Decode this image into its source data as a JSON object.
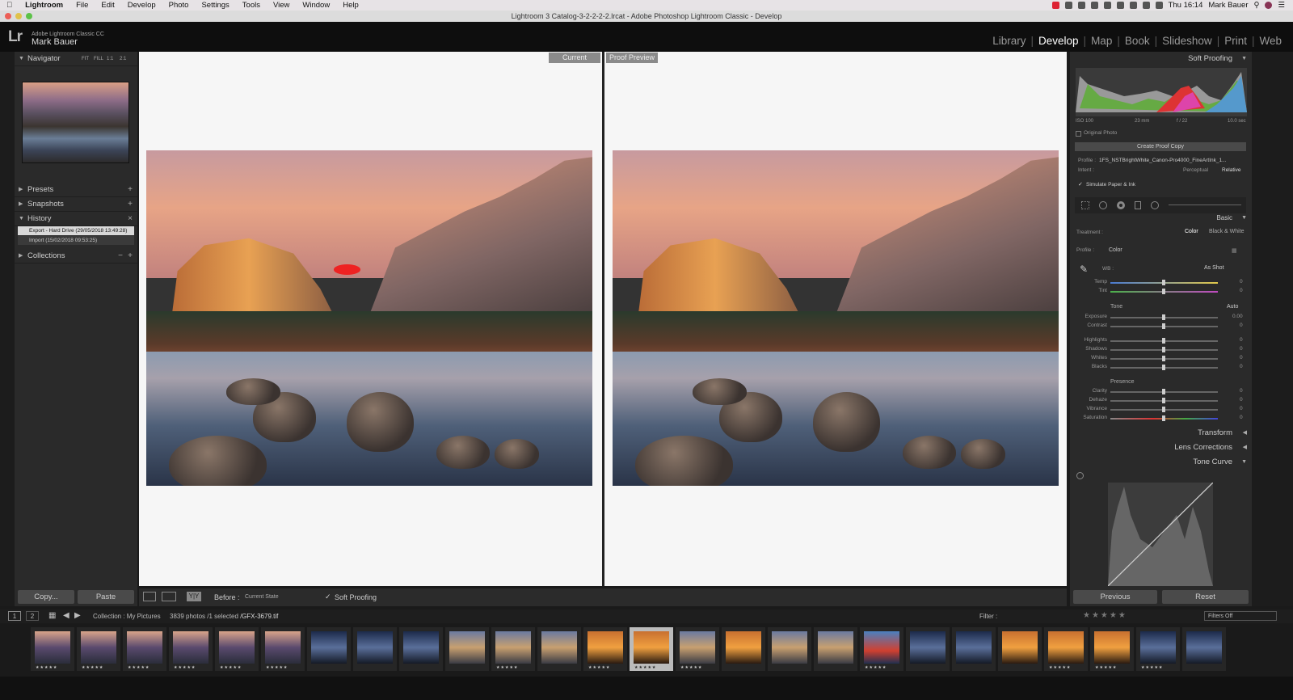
{
  "menubar": {
    "items": [
      "Lightroom",
      "File",
      "Edit",
      "Develop",
      "Photo",
      "Settings",
      "Tools",
      "View",
      "Window",
      "Help"
    ],
    "clock": "Thu 16:14",
    "user": "Mark Bauer"
  },
  "window": {
    "title": "Lightroom 3 Catalog-3-2-2-2-2.lrcat - Adobe Photoshop Lightroom Classic - Develop"
  },
  "identity": {
    "logo": "Lr",
    "product": "Adobe Lightroom Classic CC",
    "user": "Mark Bauer"
  },
  "modules": [
    {
      "label": "Library"
    },
    {
      "label": "Develop",
      "active": true
    },
    {
      "label": "Map"
    },
    {
      "label": "Book"
    },
    {
      "label": "Slideshow"
    },
    {
      "label": "Print"
    },
    {
      "label": "Web"
    }
  ],
  "left": {
    "navigator": {
      "title": "Navigator",
      "fit": "FIT",
      "fill": "FILL",
      "one": "1:1",
      "two": "2:1"
    },
    "presets": "Presets",
    "snapshots": "Snapshots",
    "history": {
      "title": "History",
      "items": [
        "Export - Hard Drive (29/05/2018 13:49:28)",
        "Import (15/02/2018 09:53:25)"
      ]
    },
    "collections": "Collections",
    "copy": "Copy...",
    "paste": "Paste"
  },
  "center": {
    "current_label": "Current",
    "proof_label": "Proof Preview"
  },
  "toolbar": {
    "before": "Before :",
    "state": "Current State",
    "soft_proofing": "Soft Proofing"
  },
  "right": {
    "soft_proofing": "Soft Proofing",
    "hist_info": {
      "iso": "ISO 100",
      "focal": "23 mm",
      "aperture": "f / 22",
      "shutter": "10.0 sec"
    },
    "original_photo": "Original Photo",
    "create_proof": "Create Proof Copy",
    "profile_label": "Profile :",
    "profile_value": "1FS_NSTBrightWhite_Canon-Pro4000_FineArtInk_1...",
    "intent_label": "Intent :",
    "intent_perceptual": "Perceptual",
    "intent_relative": "Relative",
    "simulate": "Simulate Paper & Ink",
    "basic": "Basic",
    "treatment_label": "Treatment :",
    "treatment_color": "Color",
    "treatment_bw": "Black & White",
    "profile2_label": "Profile :",
    "profile2_value": "Color",
    "wb_label": "WB :",
    "wb_value": "As Shot",
    "tone": "Tone",
    "auto": "Auto",
    "presence": "Presence",
    "sliders": [
      {
        "label": "Temp",
        "value": "0"
      },
      {
        "label": "Tint",
        "value": "0"
      },
      {
        "label": "Exposure",
        "value": "0.00"
      },
      {
        "label": "Contrast",
        "value": "0"
      },
      {
        "label": "Highlights",
        "value": "0"
      },
      {
        "label": "Shadows",
        "value": "0"
      },
      {
        "label": "Whites",
        "value": "0"
      },
      {
        "label": "Blacks",
        "value": "0"
      },
      {
        "label": "Clarity",
        "value": "0"
      },
      {
        "label": "Dehaze",
        "value": "0"
      },
      {
        "label": "Vibrance",
        "value": "0"
      },
      {
        "label": "Saturation",
        "value": "0"
      }
    ],
    "transform": "Transform",
    "lens": "Lens Corrections",
    "tone_curve": "Tone Curve",
    "previous": "Previous",
    "reset": "Reset"
  },
  "filmstrip_header": {
    "page1": "1",
    "page2": "2",
    "source": "Collection : My Pictures",
    "count": "3839 photos /1 selected /",
    "filename": "GFX-3679.tif",
    "filter": "Filter :",
    "filters_off": "Filters Off"
  },
  "filmstrip": {
    "stars": "★★★★★"
  }
}
